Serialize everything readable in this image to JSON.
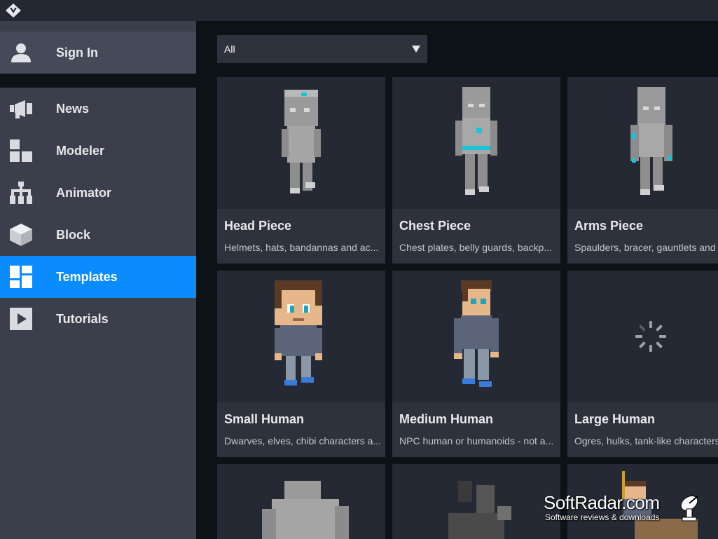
{
  "sidebar": {
    "signin": {
      "label": "Sign In",
      "icon": "user-icon"
    },
    "items": [
      {
        "label": "News",
        "icon": "megaphone-icon"
      },
      {
        "label": "Modeler",
        "icon": "modeler-blocks-icon"
      },
      {
        "label": "Animator",
        "icon": "skeleton-rig-icon"
      },
      {
        "label": "Block",
        "icon": "cube-icon"
      },
      {
        "label": "Templates",
        "icon": "templates-grid-icon",
        "active": true
      },
      {
        "label": "Tutorials",
        "icon": "play-icon"
      }
    ]
  },
  "filter": {
    "selected": "All"
  },
  "templates": [
    {
      "title": "Head Piece",
      "desc": "Helmets, hats, bandannas and ac..."
    },
    {
      "title": "Chest Piece",
      "desc": "Chest plates, belly guards, backp..."
    },
    {
      "title": "Arms Piece",
      "desc": "Spaulders, bracer, gauntlets and ..."
    },
    {
      "title": "Small Human",
      "desc": "Dwarves, elves, chibi characters a..."
    },
    {
      "title": "Medium Human",
      "desc": "NPC human or humanoids - not a..."
    },
    {
      "title": "Large Human",
      "desc": "Ogres, hulks, tank-like characters,..."
    }
  ],
  "watermark": {
    "title": "SoftRadar.com",
    "subtitle": "Software reviews & downloads"
  },
  "colors": {
    "accent": "#0a8cff",
    "sidebar": "#3a3f4b",
    "background": "#0d1216",
    "card": "#2d323c",
    "highlight": "#19c4d8"
  }
}
